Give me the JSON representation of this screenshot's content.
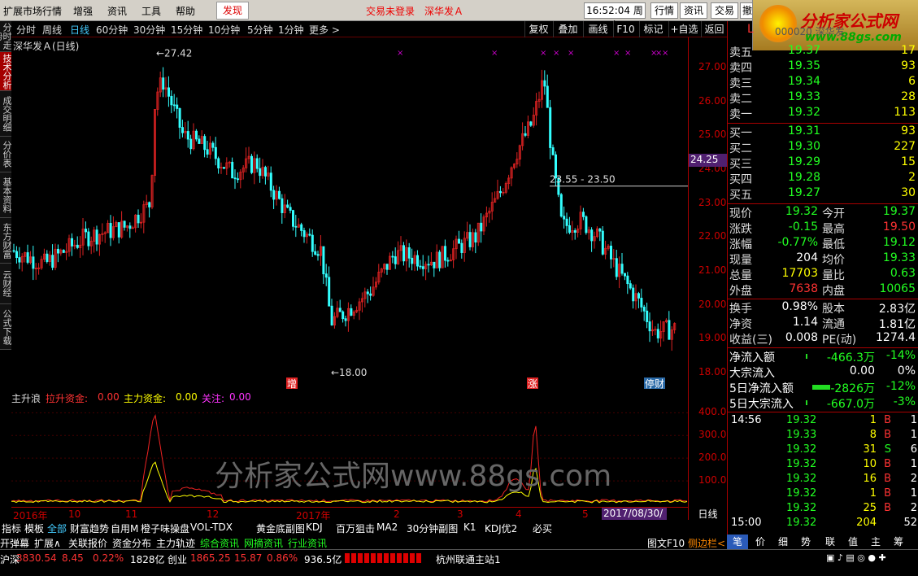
{
  "topmenu": [
    "扩展市场行情",
    "增强",
    "资讯",
    "工具",
    "帮助"
  ],
  "discover": "发现",
  "status": "交易未登录",
  "stockname_top": "深华发Ａ",
  "clock": "16:52:04 周六",
  "top_btns": [
    "行情",
    "资讯",
    "交易",
    "撤"
  ],
  "logo": {
    "text": "分析家公式网",
    "url": "www.88gs.com"
  },
  "left_tabs": [
    "分时走势",
    "技术分析",
    "成交明细",
    "分价表",
    "基本资料",
    "东方财富",
    "云财经",
    "公式下载"
  ],
  "periods": [
    "分时",
    "周线",
    "日线",
    "60分钟",
    "30分钟",
    "15分钟",
    "10分钟",
    "5分钟",
    "1分钟",
    "更多 >"
  ],
  "right_btns": [
    "复权",
    "叠加",
    "画线",
    "F10",
    "标记",
    "+自选",
    "返回"
  ],
  "chart_title": "深华发Ａ(日线)",
  "high_label": "27.42",
  "low_label": "18.00",
  "range_label": "23.55 - 23.50",
  "current_price_tag": "24.25",
  "markers": [
    "增",
    "涨",
    "停财"
  ],
  "yaxis": [
    "27.00",
    "26.00",
    "25.00",
    "24.00",
    "23.00",
    "22.00",
    "21.00",
    "20.00",
    "19.00",
    "18.00"
  ],
  "sub_title": "主升浪",
  "sub_labels": [
    {
      "name": "拉升资金:",
      "value": "0.00"
    },
    {
      "name": "主力资金:",
      "value": "0.00"
    },
    {
      "name": "关注:",
      "value": "0.00"
    }
  ],
  "sub_yaxis": [
    "400.0",
    "300.0",
    "200.0",
    "100.0"
  ],
  "dates": [
    "2016年",
    "10",
    "11",
    "12",
    "2017年",
    "2",
    "3",
    "4",
    "5"
  ],
  "date_box": "2017/08/30/三",
  "period_label": "日线",
  "nav_row": [
    "指标",
    "模板",
    "全部",
    "财富趋势",
    "自用M",
    "橙子味操盘",
    "VOL-TDX",
    "黄金底副图",
    "KDJ",
    "百万狙击",
    "MA2",
    "30分钟副图",
    "K1",
    "KDJ优2",
    "必买"
  ],
  "nav_row2": [
    "开弹幕",
    "扩展∧",
    "关联报价",
    "资金分布",
    "主力轨迹",
    "综合资讯",
    "网摘资讯",
    "行业资讯"
  ],
  "bottom_right": [
    "图文F10",
    "侧边栏<"
  ],
  "panel_tabs": [
    "笔",
    "价",
    "细",
    "势",
    "联",
    "值",
    "主",
    "筹"
  ],
  "index_bar": {
    "sh_label": "沪深",
    "sh_value": "3830.54",
    "sh_change": "8.45",
    "sh_pct": "0.22%",
    "sh_amount": "1828亿",
    "cy_label": "创业",
    "cy_value": "1865.25",
    "cy_change": "15.87",
    "cy_pct": "0.86%",
    "cy_amount": "936.5亿",
    "server": "杭州联通主站1"
  },
  "header_row": {
    "label": "L",
    "code": "000020 深华发"
  },
  "asks": [
    {
      "label": "卖五",
      "price": "19.37",
      "vol": "17"
    },
    {
      "label": "卖四",
      "price": "19.35",
      "vol": "93"
    },
    {
      "label": "卖三",
      "price": "19.34",
      "vol": "6"
    },
    {
      "label": "卖二",
      "price": "19.33",
      "vol": "28"
    },
    {
      "label": "卖一",
      "price": "19.32",
      "vol": "113"
    }
  ],
  "bids": [
    {
      "label": "买一",
      "price": "19.31",
      "vol": "93"
    },
    {
      "label": "买二",
      "price": "19.30",
      "vol": "227"
    },
    {
      "label": "买三",
      "price": "19.29",
      "vol": "15"
    },
    {
      "label": "买四",
      "price": "19.28",
      "vol": "2"
    },
    {
      "label": "买五",
      "price": "19.27",
      "vol": "30"
    }
  ],
  "quote": [
    {
      "l": "现价",
      "v": "19.32",
      "vc": "grn",
      "l2": "今开",
      "v2": "19.37",
      "v2c": "grn"
    },
    {
      "l": "涨跌",
      "v": "-0.15",
      "vc": "grn",
      "l2": "最高",
      "v2": "19.50",
      "v2c": "red"
    },
    {
      "l": "涨幅",
      "v": "-0.77%",
      "vc": "grn",
      "l2": "最低",
      "v2": "19.12",
      "v2c": "grn"
    },
    {
      "l": "现量",
      "v": "204",
      "vc": "wht",
      "l2": "均价",
      "v2": "19.33",
      "v2c": "grn"
    },
    {
      "l": "总量",
      "v": "17703",
      "vc": "yel",
      "l2": "量比",
      "v2": "0.63",
      "v2c": "grn"
    },
    {
      "l": "外盘",
      "v": "7638",
      "vc": "red",
      "l2": "内盘",
      "v2": "10065",
      "v2c": "grn"
    }
  ],
  "fund": [
    {
      "l": "换手",
      "v": "0.98%",
      "l2": "股本",
      "v2": "2.83亿"
    },
    {
      "l": "净资",
      "v": "1.14",
      "l2": "流通",
      "v2": "1.81亿"
    },
    {
      "l": "收益(三)",
      "v": "0.008",
      "l2": "PE(动)",
      "v2": "1274.4"
    }
  ],
  "flow": [
    {
      "l": "净流入额",
      "v": "-466.3万",
      "p": "-14%",
      "c": "grn"
    },
    {
      "l": "大宗流入",
      "v": "0.00",
      "p": "0%",
      "c": "wht"
    },
    {
      "l": "5日净流入额",
      "v": "-2826万",
      "p": "-12%",
      "c": "grn"
    },
    {
      "l": "5日大宗流入",
      "v": "-667.0万",
      "p": "-3%",
      "c": "grn"
    }
  ],
  "ticks": [
    {
      "t": "14:56",
      "p": "19.32",
      "v": "1",
      "d": "B",
      "n": "1"
    },
    {
      "t": "",
      "p": "19.33",
      "v": "8",
      "d": "B",
      "n": "1"
    },
    {
      "t": "",
      "p": "19.32",
      "v": "31",
      "d": "S",
      "n": "6"
    },
    {
      "t": "",
      "p": "19.32",
      "v": "10",
      "d": "B",
      "n": "1"
    },
    {
      "t": "",
      "p": "19.32",
      "v": "16",
      "d": "B",
      "n": "2"
    },
    {
      "t": "",
      "p": "19.32",
      "v": "1",
      "d": "B",
      "n": "1"
    },
    {
      "t": "",
      "p": "19.32",
      "v": "25",
      "d": "B",
      "n": "2"
    },
    {
      "t": "15:00",
      "p": "19.32",
      "v": "204",
      "d": "",
      "n": "52"
    }
  ],
  "chart_data": {
    "type": "candlestick",
    "ylim": [
      18.0,
      27.5
    ],
    "high": 27.42,
    "low": 18.0,
    "current": 24.25
  }
}
